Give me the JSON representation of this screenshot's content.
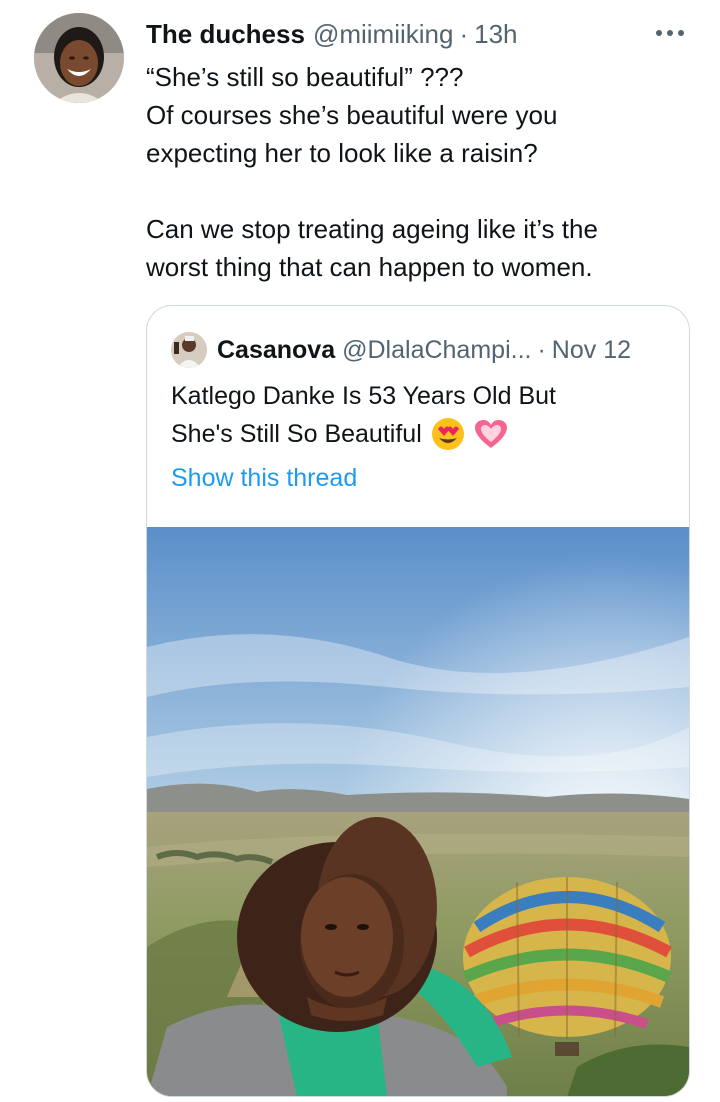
{
  "tweet": {
    "display_name": "The duchess",
    "handle": "@miimiiking",
    "separator": "·",
    "time": "13h",
    "lines": [
      "“She’s still so beautiful” ???",
      "Of courses she’s beautiful were you",
      "expecting her to look like a raisin?",
      "",
      "Can we stop treating ageing like it’s the",
      "worst thing that can happen to women."
    ],
    "more_icon": "more-horizontal-icon"
  },
  "quote": {
    "display_name": "Casanova",
    "handle": "@DlalaChampi...",
    "separator": "·",
    "time": "Nov 12",
    "line1": "Katlego Danke Is 53 Years Old But",
    "line2": "She's Still So Beautiful",
    "emojis": [
      "heart-eyes-emoji",
      "pink-heart-emoji"
    ],
    "show_thread": "Show this thread"
  },
  "colors": {
    "text": "#0f1419",
    "secondary": "#536471",
    "link": "#1d9bf0",
    "border": "#cfd9de"
  }
}
